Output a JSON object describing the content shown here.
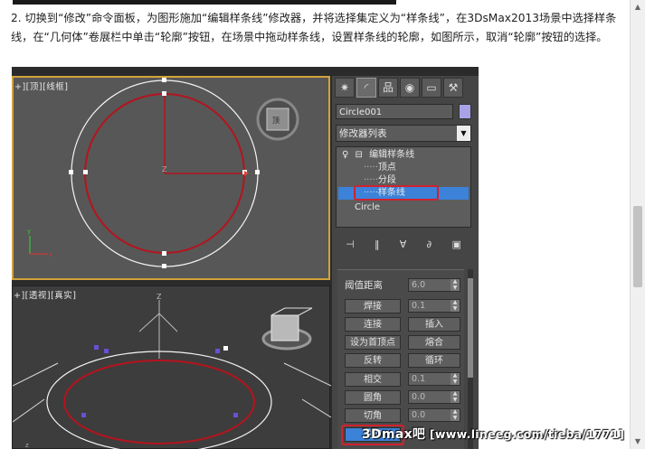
{
  "article": {
    "paragraph": "2. 切换到“修改”命令面板，为图形施加“编辑样条线”修改器，并将选择集定义为“样条线”，在3DsMax2013场景中选择样条线，在“几何体”卷展栏中单击“轮廓”按钮，在场景中拖动样条线，设置样条线的轮廓，如图所示，取消“轮廓”按钮的选择。"
  },
  "viewports": {
    "top_label": "+][顶][线框]",
    "persp_label": "+][透视][真实]"
  },
  "panel": {
    "tabs": [
      "create-icon",
      "modify-icon",
      "hierarchy-icon",
      "motion-icon",
      "display-icon",
      "utilities-icon"
    ],
    "object_name": "Circle001",
    "modifier_list": "修改器列表",
    "stack": {
      "modifier": "编辑样条线",
      "sub_vertex": "顶点",
      "sub_segment": "分段",
      "sub_spline": "样条线",
      "base": "Circle"
    },
    "rollout": {
      "threshold_label": "阈值距离",
      "threshold_value": "6.0",
      "weld": "焊接",
      "weld_value": "0.1",
      "connect": "连接",
      "insert": "插入",
      "make_first": "设为首顶点",
      "fuse": "熔合",
      "reverse": "反转",
      "cycle": "循环",
      "cross_insert": "相交",
      "cross_value": "0.1",
      "fillet": "圆角",
      "fillet_value": "0.0",
      "chamfer": "切角",
      "chamfer_value": "0.0",
      "outline": "轮廓"
    }
  },
  "watermark": {
    "brand": "3Dmax吧",
    "url": "[www.lineeg.com/tieba/1771]"
  },
  "colors": {
    "highlight": "#3b82d8",
    "callout": "#d0222e",
    "active_viewport": "#d2a23a"
  }
}
